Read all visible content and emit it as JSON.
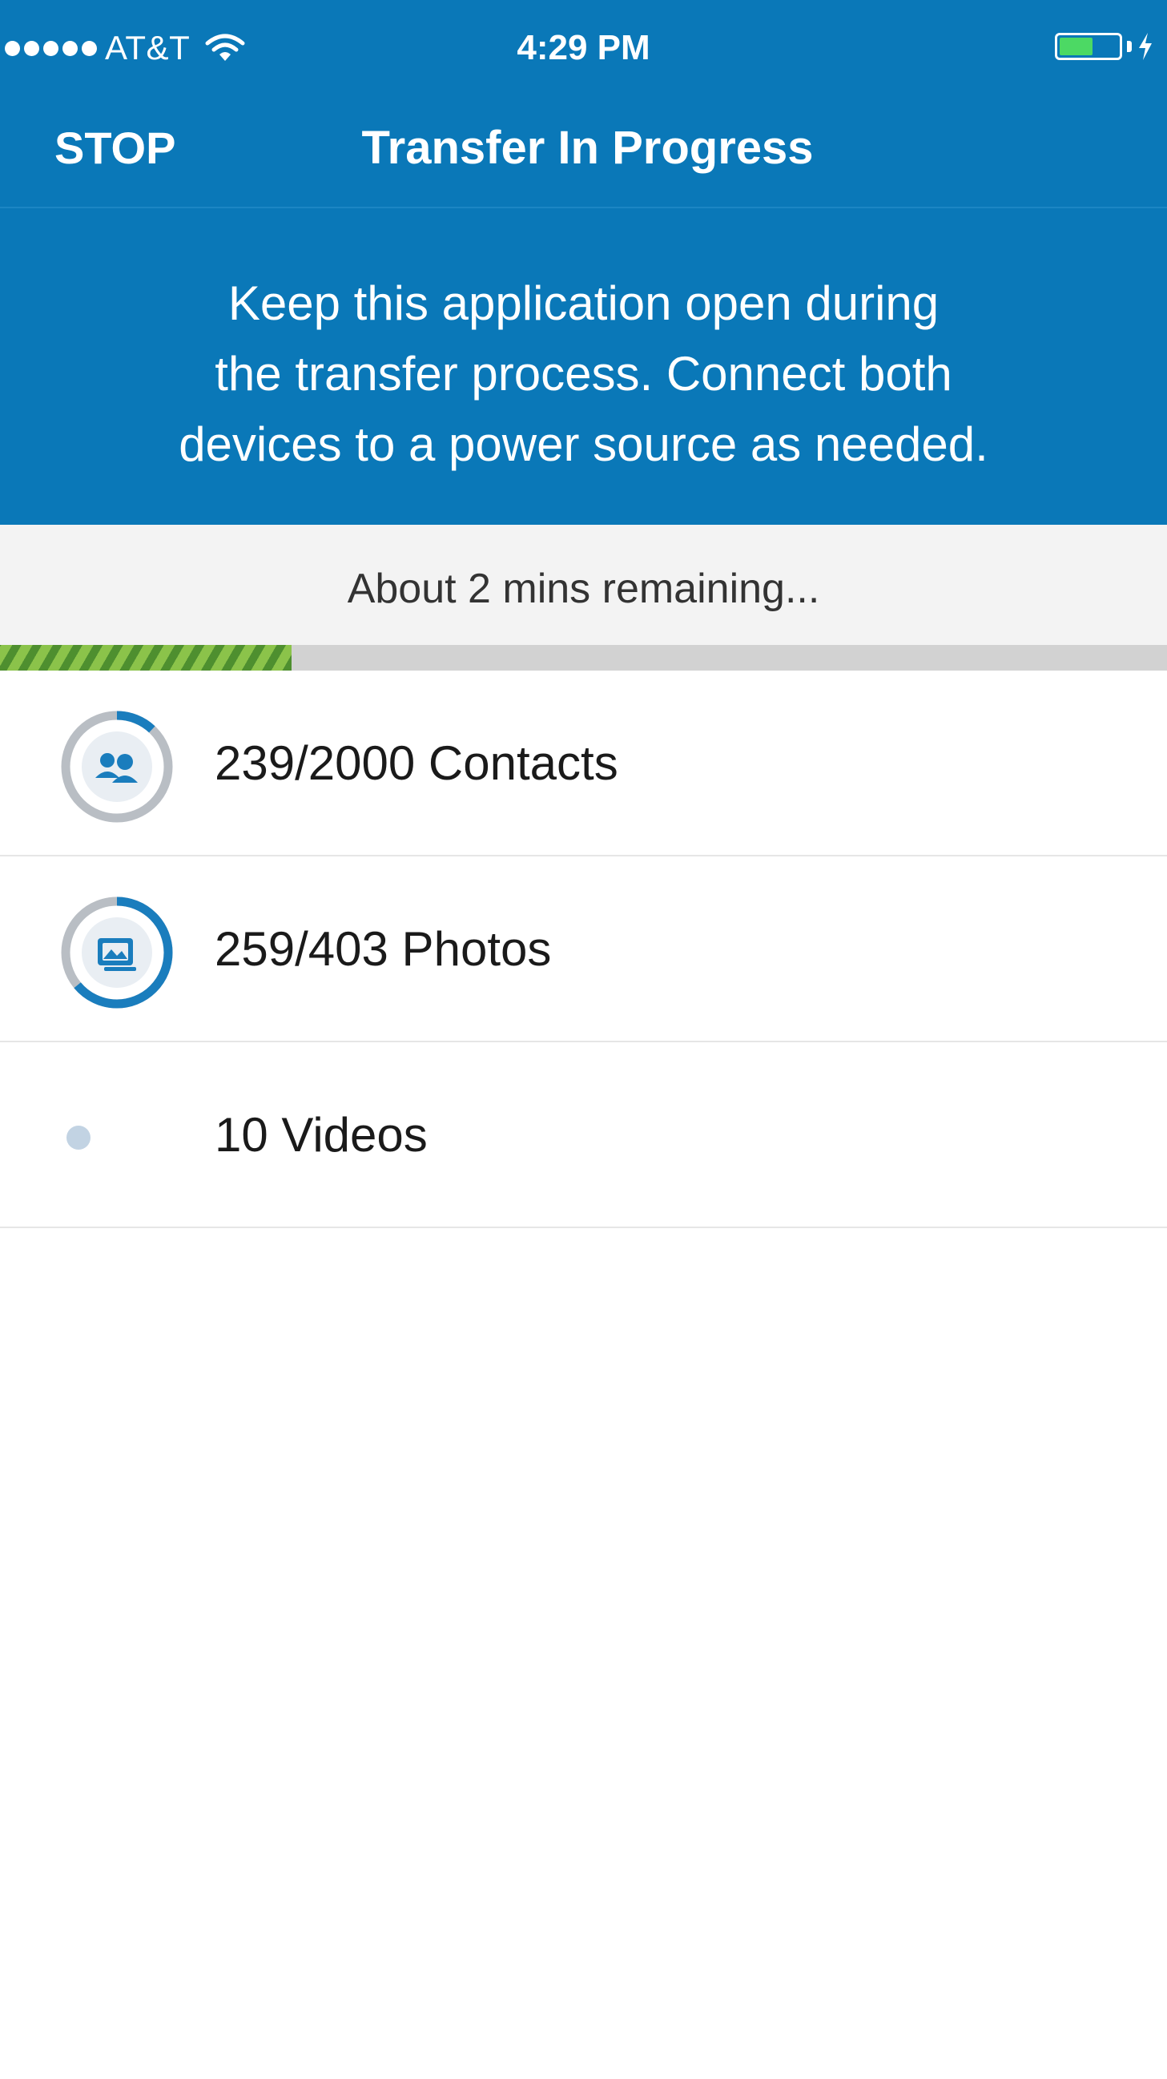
{
  "status_bar": {
    "carrier": "AT&T",
    "time": "4:29 PM",
    "signal_dots": 5,
    "battery_level": 0.6,
    "charging": true
  },
  "nav": {
    "stop_label": "STOP",
    "title": "Transfer In Progress"
  },
  "info": {
    "lines": [
      "Keep this application open during",
      "the transfer process. Connect both",
      "devices to a power source as needed."
    ]
  },
  "progress": {
    "remaining_text": "About 2 mins remaining...",
    "fraction": 0.25
  },
  "items": [
    {
      "label": "239/2000 Contacts",
      "icon": "contacts-icon",
      "state": "in-progress",
      "fraction": 0.12
    },
    {
      "label": "259/403 Photos",
      "icon": "photos-icon",
      "state": "in-progress",
      "fraction": 0.64
    },
    {
      "label": "10 Videos",
      "icon": "pending-dot-icon",
      "state": "pending",
      "fraction": 0
    }
  ],
  "colors": {
    "header_bg": "#0a78b8",
    "accent": "#1a7dbd",
    "ring_track": "#b9bec4",
    "progress_fill": "#8bc34a",
    "battery_fill": "#4cd964"
  }
}
